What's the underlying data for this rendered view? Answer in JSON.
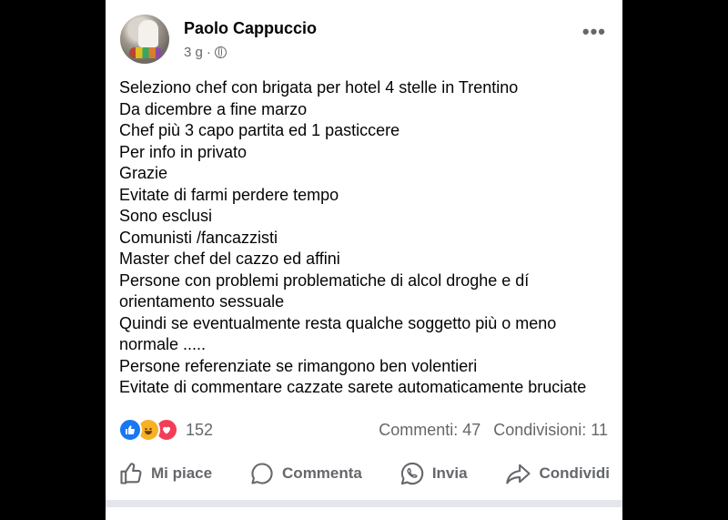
{
  "post": {
    "author": "Paolo Cappuccio",
    "time": "3 g",
    "separator": "·",
    "privacy_icon": "globe-icon",
    "more_icon": "more-options-icon",
    "lines": [
      "Seleziono chef con brigata per hotel 4 stelle in Trentino",
      "Da dicembre a fine marzo",
      "Chef più 3 capo partita ed 1 pasticcere",
      "Per info in privato",
      "Grazie",
      "Evitate di farmi perdere tempo",
      "Sono esclusi",
      "Comunisti /fancazzisti",
      "Master chef del cazzo ed affini",
      "Persone con problemi problematiche di alcol droghe e dí orientamento sessuale",
      "Quindi se eventualmente resta qualche soggetto più o meno normale .....",
      "Persone referenziate se rimangono ben volentieri",
      "Evitate di commentare cazzate sarete automaticamente bruciate"
    ]
  },
  "stats": {
    "reaction_count": "152",
    "comments": "Commenti: 47",
    "shares": "Condivisioni: 11",
    "reaction_icons": [
      "like-icon",
      "haha-icon",
      "love-icon"
    ],
    "colors": {
      "like": "#1877f2",
      "haha": "#f7b125",
      "love": "#f33e58"
    }
  },
  "actions": {
    "like": "Mi piace",
    "comment": "Commenta",
    "send": "Invia",
    "share": "Condividi"
  }
}
